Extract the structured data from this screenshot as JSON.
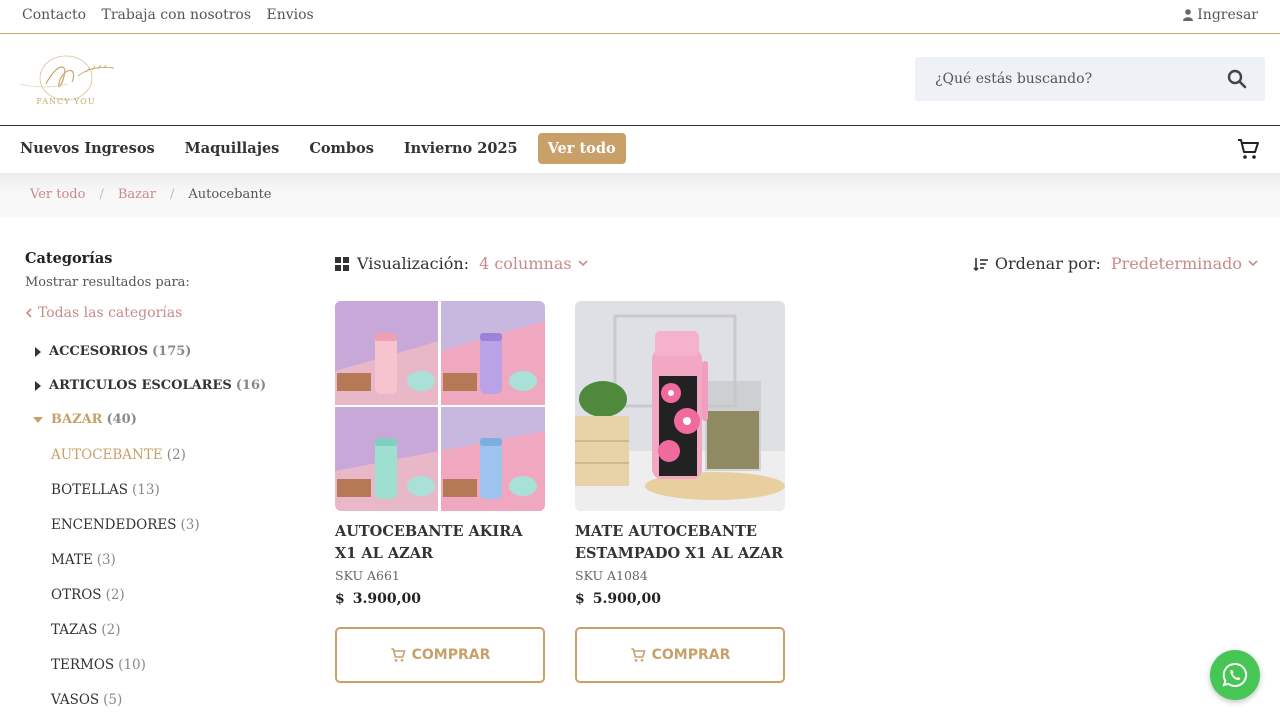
{
  "topbar": {
    "links": [
      "Contacto",
      "Trabaja con nosotros",
      "Envios"
    ],
    "login": "Ingresar"
  },
  "header": {
    "logo_text": "FANCY YOU",
    "search_placeholder": "¿Qué estás buscando?"
  },
  "nav": {
    "items": [
      "Nuevos Ingresos",
      "Maquillajes",
      "Combos",
      "Invierno 2025"
    ],
    "view_all": "Ver todo"
  },
  "breadcrumb": [
    "Ver todo",
    "Bazar",
    "Autocebante"
  ],
  "sidebar": {
    "title": "Categorías",
    "subtitle": "Mostrar resultados para:",
    "all_categories": "Todas las categorías",
    "categories": [
      {
        "name": "ACCESORIOS",
        "count": "(175)"
      },
      {
        "name": "ARTICULOS ESCOLARES",
        "count": "(16)"
      },
      {
        "name": "BAZAR",
        "count": "(40)"
      }
    ],
    "subcategories": [
      {
        "name": "AUTOCEBANTE",
        "count": "(2)"
      },
      {
        "name": "BOTELLAS",
        "count": "(13)"
      },
      {
        "name": "ENCENDEDORES",
        "count": "(3)"
      },
      {
        "name": "MATE",
        "count": "(3)"
      },
      {
        "name": "OTROS",
        "count": "(2)"
      },
      {
        "name": "TAZAS",
        "count": "(2)"
      },
      {
        "name": "TERMOS",
        "count": "(10)"
      },
      {
        "name": "VASOS",
        "count": "(5)"
      }
    ]
  },
  "toolbar": {
    "view_label": "Visualización:",
    "view_value": "4 columnas",
    "sort_label": "Ordenar por:",
    "sort_value": "Predeterminado"
  },
  "products": [
    {
      "name": "AUTOCEBANTE AKIRA X1 AL AZAR",
      "sku": "SKU A661",
      "currency": "$",
      "price": "3.900,00",
      "button": "COMPRAR"
    },
    {
      "name": "MATE AUTOCEBANTE ESTAMPADO X1 AL AZAR",
      "sku": "SKU A1084",
      "currency": "$",
      "price": "5.900,00",
      "button": "COMPRAR"
    }
  ],
  "colors": {
    "accent": "#c9a06a",
    "link": "#c98a8a",
    "whatsapp": "#45c655"
  }
}
